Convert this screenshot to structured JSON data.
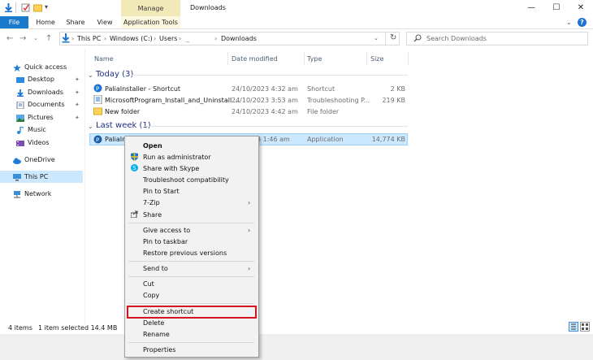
{
  "window": {
    "title": "Downloads",
    "manage_label": "Manage",
    "minimize": "—",
    "maximize": "☐",
    "close": "✕"
  },
  "ribbon": {
    "file": "File",
    "home": "Home",
    "share": "Share",
    "view": "View",
    "app_tools": "Application Tools",
    "help": "?"
  },
  "address": {
    "crumbs": [
      "This PC",
      "Windows (C:)",
      "Users",
      "_",
      "Downloads"
    ],
    "search_placeholder": "Search Downloads"
  },
  "nav": {
    "items": [
      {
        "label": "Quick access",
        "icon": "star-icon"
      },
      {
        "label": "Desktop",
        "icon": "desktop-icon"
      },
      {
        "label": "Downloads",
        "icon": "download-icon"
      },
      {
        "label": "Documents",
        "icon": "documents-icon"
      },
      {
        "label": "Pictures",
        "icon": "pictures-icon"
      },
      {
        "label": "Music",
        "icon": "music-icon"
      },
      {
        "label": "Videos",
        "icon": "videos-icon"
      },
      {
        "label": "OneDrive",
        "icon": "cloud-icon"
      },
      {
        "label": "This PC",
        "icon": "computer-icon"
      },
      {
        "label": "Network",
        "icon": "network-icon"
      }
    ]
  },
  "columns": {
    "name": "Name",
    "date": "Date modified",
    "type": "Type",
    "size": "Size"
  },
  "groups": {
    "today": "Today (3)",
    "last_week": "Last week (1)"
  },
  "files": [
    {
      "name": "PaliaInstaller - Shortcut",
      "date": "24/10/2023 4:32 am",
      "type": "Shortcut",
      "size": "2 KB"
    },
    {
      "name": "MicrosoftProgram_Install_and_Uninstall....",
      "date": "24/10/2023 3:53 am",
      "type": "Troubleshooting P...",
      "size": "219 KB"
    },
    {
      "name": "New folder",
      "date": "24/10/2023 4:42 am",
      "type": "File folder",
      "size": ""
    },
    {
      "name": "PaliaIns",
      "date": "3 1:46 am",
      "type": "Application",
      "size": "14,774 KB"
    }
  ],
  "status": {
    "items": "4 items",
    "selected": "1 item selected  14.4 MB"
  },
  "context_menu": {
    "open": "Open",
    "run_admin": "Run as administrator",
    "share_skype": "Share with Skype",
    "troubleshoot": "Troubleshoot compatibility",
    "pin_start": "Pin to Start",
    "zip": "7-Zip",
    "share": "Share",
    "give_access": "Give access to",
    "pin_taskbar": "Pin to taskbar",
    "restore": "Restore previous versions",
    "send_to": "Send to",
    "cut": "Cut",
    "copy": "Copy",
    "create_shortcut": "Create shortcut",
    "delete": "Delete",
    "rename": "Rename",
    "properties": "Properties"
  },
  "colors": {
    "accent": "#1979ca",
    "selection": "#cce8ff",
    "highlight_border": "#d4131f"
  }
}
